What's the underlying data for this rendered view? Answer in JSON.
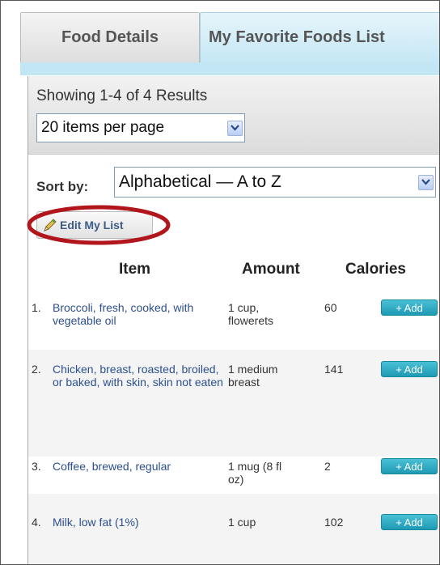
{
  "tabs": [
    {
      "label": "Food Details",
      "active": false
    },
    {
      "label": "My Favorite Foods List",
      "active": true
    }
  ],
  "results": {
    "showing": "Showing 1-4 of 4 Results",
    "per_page": "20 items per page"
  },
  "sort": {
    "label": "Sort by:",
    "value": "Alphabetical — A to Z"
  },
  "edit_button": "Edit My List",
  "columns": {
    "item": "Item",
    "amount": "Amount",
    "calories": "Calories"
  },
  "rows": [
    {
      "num": "1.",
      "item": "Broccoli, fresh, cooked, with vegetable oil",
      "amount": "1 cup, flowerets",
      "calories": "60",
      "add": "+ Add"
    },
    {
      "num": "2.",
      "item": "Chicken, breast, roasted, broiled, or baked, with skin, skin not eaten",
      "amount": "1 medium breast",
      "calories": "141",
      "add": "+ Add"
    },
    {
      "num": "3.",
      "item": "Coffee, brewed, regular",
      "amount": "1 mug (8 fl oz)",
      "calories": "2",
      "add": "+ Add"
    },
    {
      "num": "4.",
      "item": "Milk, low fat (1%)",
      "amount": "1 cup",
      "calories": "102",
      "add": "+ Add"
    }
  ],
  "colors": {
    "accent": "#2ba8c2",
    "link": "#2d4f8e",
    "tab_active": "#c5e7f5",
    "highlight_ring": "#b0161c"
  },
  "icons": {
    "dropdown": "chevron-down-icon",
    "edit": "pencil-icon"
  }
}
